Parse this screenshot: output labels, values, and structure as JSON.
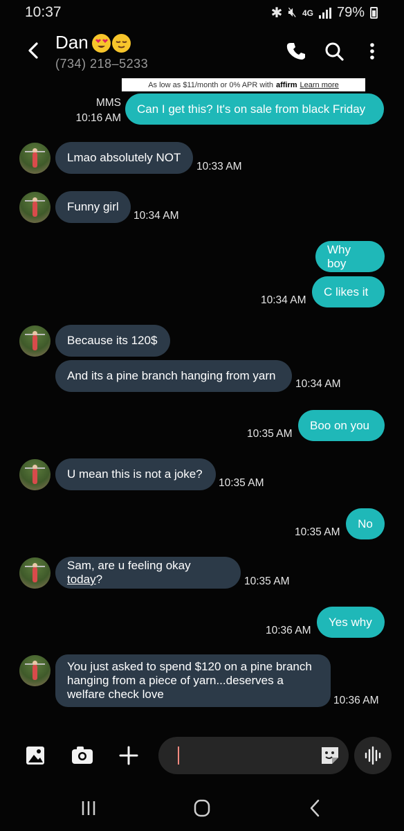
{
  "status_bar": {
    "time": "10:37",
    "network": "4G",
    "network_sub": "LTE",
    "battery": "79%"
  },
  "header": {
    "contact_name": "Dan",
    "phone_number": "(734) 218–5233",
    "icons": [
      "back-arrow-icon",
      "phone-icon",
      "search-icon",
      "more-vertical-icon"
    ]
  },
  "ad_banner": {
    "text": "As low as $11/month or 0% APR with",
    "brand": "affirm",
    "link": "Learn more"
  },
  "messages": [
    {
      "dir": "out",
      "text": "Can I get this? It's on sale from black Friday",
      "label": "MMS",
      "time": "10:16 AM"
    },
    {
      "dir": "in",
      "text": "Lmao absolutely NOT",
      "time": "10:33 AM"
    },
    {
      "dir": "in",
      "text": "Funny girl",
      "time": "10:34 AM"
    },
    {
      "dir": "out",
      "text": "Why boy"
    },
    {
      "dir": "out",
      "text": "C likes it",
      "time": "10:34 AM"
    },
    {
      "dir": "in",
      "text": "Because its 120$"
    },
    {
      "dir": "in",
      "text": "And its a pine branch hanging from yarn",
      "time": "10:34 AM"
    },
    {
      "dir": "out",
      "text": "Boo on you",
      "time": "10:35 AM"
    },
    {
      "dir": "in",
      "text": "U mean this is not a joke?",
      "time": "10:35 AM"
    },
    {
      "dir": "out",
      "text": "No",
      "time": "10:35 AM"
    },
    {
      "dir": "in",
      "text_before": "Sam, are u feeling okay ",
      "text_link": "today",
      "text_after": "?",
      "time": "10:35 AM"
    },
    {
      "dir": "out",
      "text": "Yes why",
      "time": "10:36 AM"
    },
    {
      "dir": "in",
      "line1": "You just asked to spend $120 on a pine branch",
      "line2": "hanging from a piece of yarn...deserves a",
      "line3": "welfare check love",
      "time": "10:36 AM"
    }
  ],
  "composer": {
    "placeholder": "",
    "icons": [
      "gallery-icon",
      "camera-icon",
      "plus-icon",
      "sticker-icon",
      "voice-icon"
    ]
  },
  "colors": {
    "background": "#050505",
    "incoming_bubble": "#2c3a48",
    "outgoing_bubble": "#1fb8b8"
  }
}
